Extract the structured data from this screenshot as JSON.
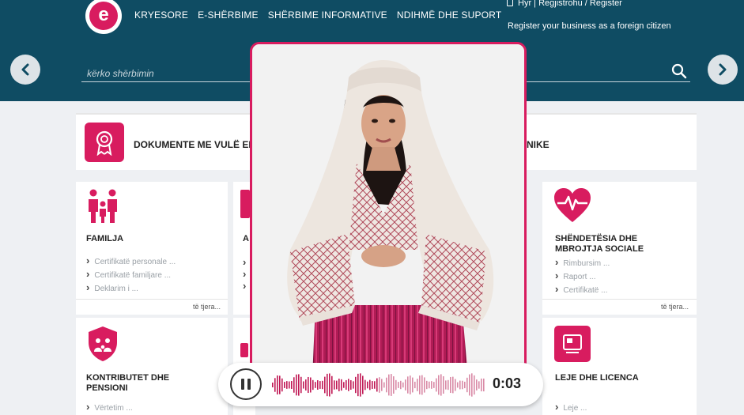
{
  "header": {
    "logo_letter": "e",
    "nav": [
      "KRYESORE",
      "E-SHËRBIME",
      "SHËRBIME INFORMATIVE",
      "NDIHMË DHE SUPORT"
    ],
    "login_links": "Hyr | Regjistrohu / Register",
    "foreign_link": "Register your business as a foreign citizen",
    "search_placeholder": "kërko shërbimin"
  },
  "banner": {
    "text_left": "DOKUMENTE ME VULË EL",
    "text_right": "NIKE"
  },
  "cards": {
    "familja": {
      "title": "FAMILJA",
      "links": [
        "Certifikatë personale ...",
        "Certifikatë familjare ...",
        "Deklarim i ... "
      ],
      "more": "të tjera..."
    },
    "shendetesia": {
      "title": "SHËNDETËSIA DHE MBROJTJA SOCIALE",
      "links": [
        "Rimbursim ... ",
        "Raport ... ",
        "Certifikatë ... "
      ],
      "more": "të tjera..."
    },
    "kontributet": {
      "title": "KONTRIBUTET DHE PENSIONI",
      "links": [
        "Vërtetim ... "
      ]
    },
    "leje": {
      "title": "LEJE DHE LICENCA",
      "links": [
        "Leje ... "
      ]
    },
    "partial_letter": "A"
  },
  "player": {
    "time": "0:03"
  },
  "colors": {
    "header": "#0f4c63",
    "accent": "#d81c5f"
  }
}
